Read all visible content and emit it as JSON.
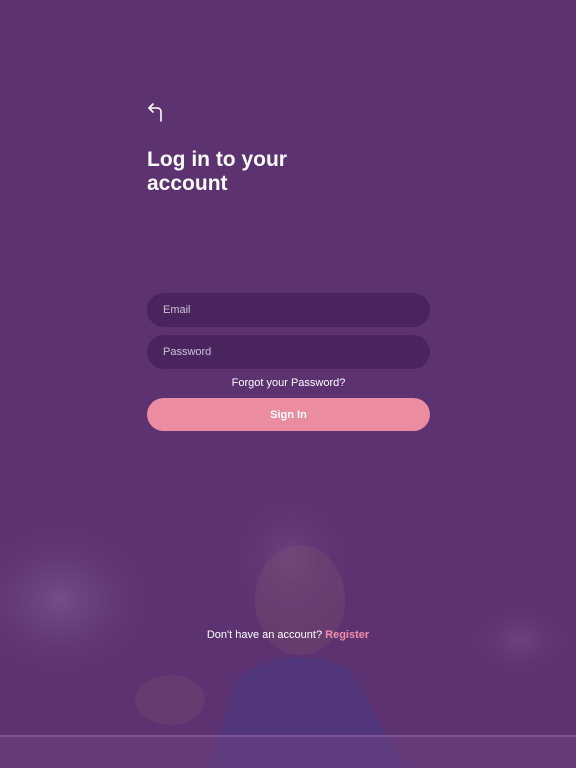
{
  "colors": {
    "background": "#5c3270",
    "accent": "#ec8ca0",
    "register_link": "#f28ea8",
    "text": "#ffffff"
  },
  "header": {
    "back_icon": "back-arrow-icon",
    "title": "Log in to your account"
  },
  "form": {
    "email_placeholder": "Email",
    "email_value": "",
    "password_placeholder": "Password",
    "password_value": "",
    "forgot_password_label": "Forgot your Password?",
    "sign_in_label": "Sign In"
  },
  "footer": {
    "prompt": "Don't have an account?",
    "register_label": "Register"
  }
}
